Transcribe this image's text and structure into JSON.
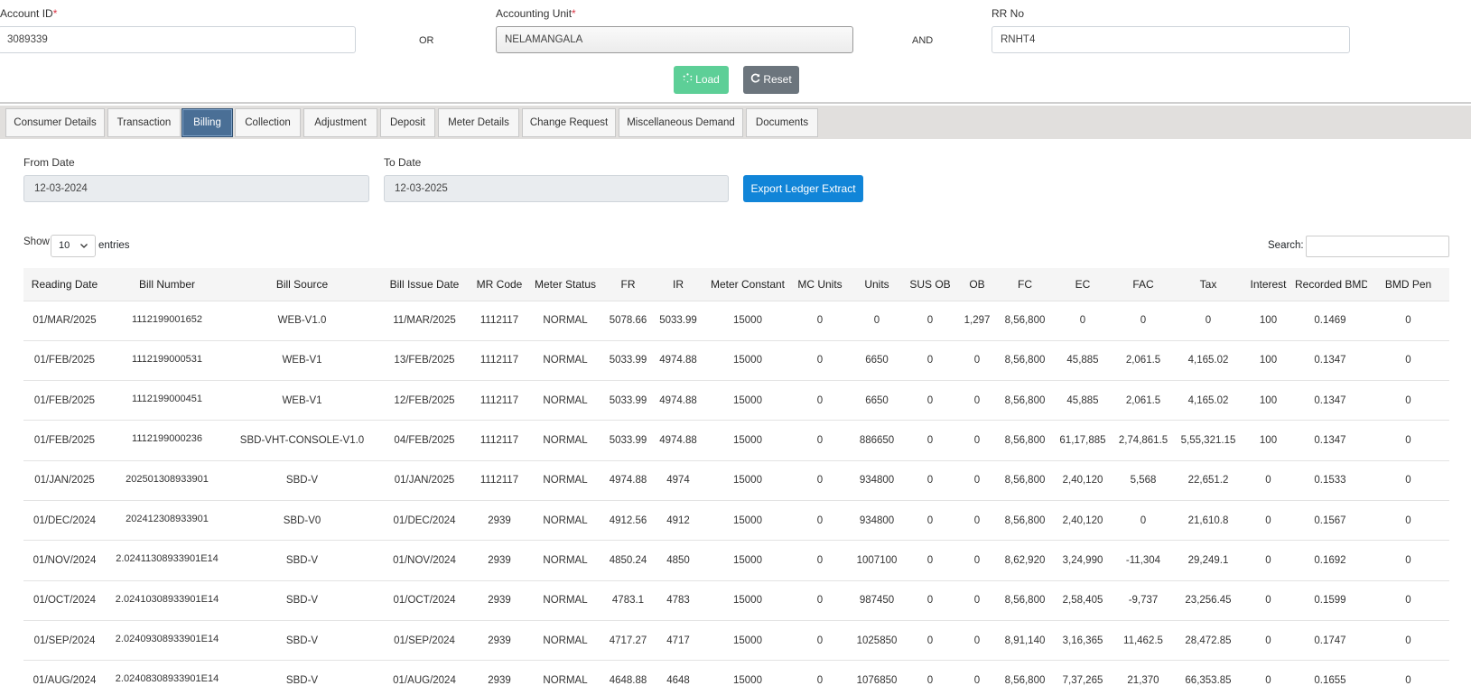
{
  "form": {
    "account_id_label": "Account ID",
    "account_id_value": "3089339",
    "or_label": "OR",
    "accounting_unit_label": "Accounting Unit",
    "accounting_unit_value": "NELAMANGALA",
    "and_label": "AND",
    "rr_no_label": "RR No",
    "rr_no_value": "RNHT4",
    "required_mark": "*",
    "load_label": "Load",
    "reset_label": "Reset"
  },
  "tabs": [
    "Consumer Details",
    "Transaction",
    "Billing",
    "Collection",
    "Adjustment",
    "Deposit",
    "Meter Details",
    "Change Request",
    "Miscellaneous Demand",
    "Documents"
  ],
  "active_tab": "Billing",
  "filters": {
    "from_date_label": "From Date",
    "from_date_value": "12-03-2024",
    "to_date_label": "To Date",
    "to_date_value": "12-03-2025",
    "export_label": "Export Ledger Extract"
  },
  "datatable": {
    "show_label": "Show",
    "page_length": "10",
    "entries_label": "entries",
    "search_label": "Search:",
    "search_value": ""
  },
  "table": {
    "columns": [
      "Reading Date",
      "Bill Number",
      "Bill Source",
      "Bill Issue Date",
      "MR Code",
      "Meter Status",
      "FR",
      "IR",
      "Meter Constant",
      "MC Units",
      "Units",
      "SUS OB",
      "OB",
      "FC",
      "EC",
      "FAC",
      "Tax",
      "Interest",
      "Recorded BMD",
      "BMD Pen"
    ],
    "rows": [
      [
        "01/MAR/2025",
        "1112199001652",
        "WEB-V1.0",
        "11/MAR/2025",
        "1112117",
        "NORMAL",
        "5078.66",
        "5033.99",
        "15000",
        "0",
        "0",
        "0",
        "1,297",
        "8,56,800",
        "0",
        "0",
        "0",
        "100",
        "0.1469",
        "0"
      ],
      [
        "01/FEB/2025",
        "1112199000531",
        "WEB-V1",
        "13/FEB/2025",
        "1112117",
        "NORMAL",
        "5033.99",
        "4974.88",
        "15000",
        "0",
        "6650",
        "0",
        "0",
        "8,56,800",
        "45,885",
        "2,061.5",
        "4,165.02",
        "100",
        "0.1347",
        "0"
      ],
      [
        "01/FEB/2025",
        "1112199000451",
        "WEB-V1",
        "12/FEB/2025",
        "1112117",
        "NORMAL",
        "5033.99",
        "4974.88",
        "15000",
        "0",
        "6650",
        "0",
        "0",
        "8,56,800",
        "45,885",
        "2,061.5",
        "4,165.02",
        "100",
        "0.1347",
        "0"
      ],
      [
        "01/FEB/2025",
        "1112199000236",
        "SBD-VHT-CONSOLE-V1.0",
        "04/FEB/2025",
        "1112117",
        "NORMAL",
        "5033.99",
        "4974.88",
        "15000",
        "0",
        "886650",
        "0",
        "0",
        "8,56,800",
        "61,17,885",
        "2,74,861.5",
        "5,55,321.15",
        "100",
        "0.1347",
        "0"
      ],
      [
        "01/JAN/2025",
        "202501308933901",
        "SBD-V",
        "01/JAN/2025",
        "1112117",
        "NORMAL",
        "4974.88",
        "4974",
        "15000",
        "0",
        "934800",
        "0",
        "0",
        "8,56,800",
        "2,40,120",
        "5,568",
        "22,651.2",
        "0",
        "0.1533",
        "0"
      ],
      [
        "01/DEC/2024",
        "202412308933901",
        "SBD-V0",
        "01/DEC/2024",
        "2939",
        "NORMAL",
        "4912.56",
        "4912",
        "15000",
        "0",
        "934800",
        "0",
        "0",
        "8,56,800",
        "2,40,120",
        "0",
        "21,610.8",
        "0",
        "0.1567",
        "0"
      ],
      [
        "01/NOV/2024",
        "2.02411308933901E14",
        "SBD-V",
        "01/NOV/2024",
        "2939",
        "NORMAL",
        "4850.24",
        "4850",
        "15000",
        "0",
        "1007100",
        "0",
        "0",
        "8,62,920",
        "3,24,990",
        "-11,304",
        "29,249.1",
        "0",
        "0.1692",
        "0"
      ],
      [
        "01/OCT/2024",
        "2.02410308933901E14",
        "SBD-V",
        "01/OCT/2024",
        "2939",
        "NORMAL",
        "4783.1",
        "4783",
        "15000",
        "0",
        "987450",
        "0",
        "0",
        "8,56,800",
        "2,58,405",
        "-9,737",
        "23,256.45",
        "0",
        "0.1599",
        "0"
      ],
      [
        "01/SEP/2024",
        "2.02409308933901E14",
        "SBD-V",
        "01/SEP/2024",
        "2939",
        "NORMAL",
        "4717.27",
        "4717",
        "15000",
        "0",
        "1025850",
        "0",
        "0",
        "8,91,140",
        "3,16,365",
        "11,462.5",
        "28,472.85",
        "0",
        "0.1747",
        "0"
      ],
      [
        "01/AUG/2024",
        "2.02408308933901E14",
        "SBD-V",
        "01/AUG/2024",
        "2939",
        "NORMAL",
        "4648.88",
        "4648",
        "15000",
        "0",
        "1076850",
        "0",
        "0",
        "8,56,800",
        "7,37,265",
        "21,370",
        "66,353.85",
        "0",
        "0.1655",
        "0"
      ]
    ]
  },
  "colors": {
    "active_tab": "#4a6f96",
    "load_button": "#5dcf97",
    "reset_button": "#6c757d",
    "export_button": "#1185d8",
    "required": "#dc3545"
  },
  "icons": {
    "load": "spinner-icon",
    "reset": "refresh-icon",
    "select": "chevron-down-icon"
  }
}
